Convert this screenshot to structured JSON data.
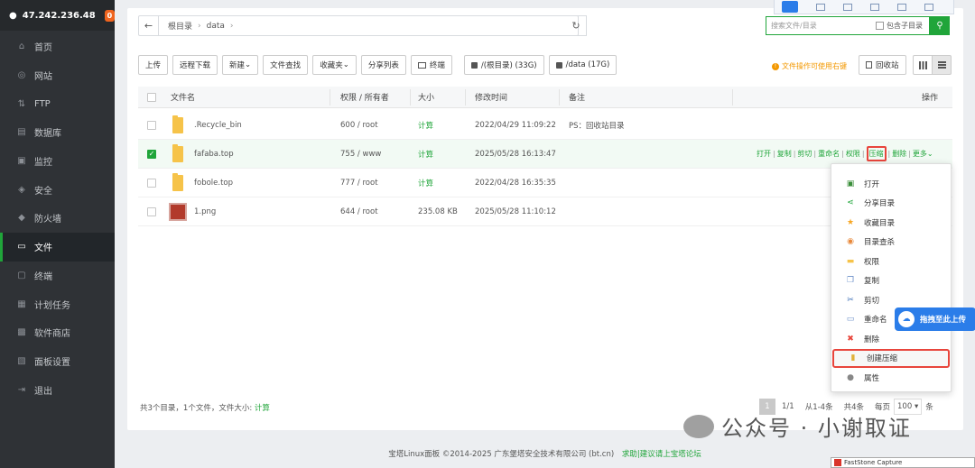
{
  "sidebar": {
    "ip": "47.242.236.48",
    "badge": "0",
    "items": [
      {
        "label": "首页",
        "icon": "home-icon"
      },
      {
        "label": "网站",
        "icon": "globe-icon"
      },
      {
        "label": "FTP",
        "icon": "ftp-icon"
      },
      {
        "label": "数据库",
        "icon": "database-icon"
      },
      {
        "label": "监控",
        "icon": "monitor-icon"
      },
      {
        "label": "安全",
        "icon": "shield-icon"
      },
      {
        "label": "防火墙",
        "icon": "firewall-icon"
      },
      {
        "label": "文件",
        "icon": "folder-icon",
        "active": true
      },
      {
        "label": "终端",
        "icon": "terminal-icon"
      },
      {
        "label": "计划任务",
        "icon": "calendar-icon"
      },
      {
        "label": "软件商店",
        "icon": "apps-icon"
      },
      {
        "label": "面板设置",
        "icon": "settings-icon"
      },
      {
        "label": "退出",
        "icon": "logout-icon"
      }
    ]
  },
  "path": {
    "root": "根目录",
    "dir": "data"
  },
  "search": {
    "placeholder": "搜索文件/目录",
    "include_sub": "包含子目录"
  },
  "toolbar": {
    "upload": "上传",
    "remote_download": "远程下载",
    "new": "新建",
    "file_search": "文件查找",
    "favorites": "收藏夹",
    "share_list": "分享列表",
    "terminal": "终端",
    "disk_root": "/(根目录) (33G)",
    "disk_data": "/data (17G)"
  },
  "hint": "文件操作可使用右键",
  "recycle": "回收站",
  "table": {
    "headers": {
      "name": "文件名",
      "perm": "权限 / 所有者",
      "size": "大小",
      "mtime": "修改时间",
      "note": "备注",
      "ops": "操作"
    },
    "rows": [
      {
        "name": ".Recycle_bin",
        "perm": "600 / root",
        "size": "计算",
        "mtime": "2022/04/29 11:09:22",
        "note": "PS：回收站目录",
        "type": "folder"
      },
      {
        "name": "fafaba.top",
        "perm": "755 / www",
        "size": "计算",
        "mtime": "2025/05/28 16:13:47",
        "note": "",
        "type": "folder",
        "selected": true
      },
      {
        "name": "fobole.top",
        "perm": "777 / root",
        "size": "计算",
        "mtime": "2022/04/28 16:35:35",
        "note": "",
        "type": "folder"
      },
      {
        "name": "1.png",
        "perm": "644 / root",
        "size": "235.08 KB",
        "mtime": "2025/05/28 11:10:12",
        "note": "",
        "type": "image"
      }
    ],
    "row_ops": {
      "open": "打开",
      "copy": "复制",
      "cut": "剪切",
      "rename": "重命名",
      "perm": "权限",
      "compress": "压缩",
      "delete": "删除",
      "more": "更多"
    }
  },
  "context_menu": [
    {
      "label": "打开",
      "icon": "open-icon",
      "color": "#3a8e3a"
    },
    {
      "label": "分享目录",
      "icon": "share-icon",
      "color": "#20a53a"
    },
    {
      "label": "收藏目录",
      "icon": "star-icon",
      "color": "#f6a623"
    },
    {
      "label": "目录查杀",
      "icon": "scan-icon",
      "color": "#e8883a"
    },
    {
      "label": "权限",
      "icon": "lock-icon",
      "color": "#f6c349"
    },
    {
      "label": "复制",
      "icon": "copy-icon",
      "color": "#6b8fc9"
    },
    {
      "label": "剪切",
      "icon": "scissors-icon",
      "color": "#3d6fb6"
    },
    {
      "label": "重命名",
      "icon": "rename-icon",
      "color": "#6b8fc9"
    },
    {
      "label": "删除",
      "icon": "delete-icon",
      "color": "#e8453c"
    },
    {
      "label": "创建压缩",
      "icon": "archive-icon",
      "color": "#e0b13a",
      "highlight": true
    },
    {
      "label": "属性",
      "icon": "properties-icon",
      "color": "#888888"
    }
  ],
  "upload_float": "拖拽至此上传",
  "summary": {
    "text": "共3个目录，1个文件，文件大小:",
    "calc": "计算"
  },
  "pager": {
    "current": "1",
    "total_pages": "1/1",
    "range": "从1-4条",
    "total": "共4条",
    "per_page_label": "每页",
    "per_page": "100",
    "unit": "条"
  },
  "watermark": "公众号 · 小谢取证",
  "copyright": {
    "text": "宝塔Linux面板 ©2014-2025 广东堡塔安全技术有限公司 (bt.cn)",
    "link": "求助|建议请上宝塔论坛"
  },
  "faststone": "FastStone Capture",
  "colors": {
    "accent": "#20a53a",
    "sidebar_bg": "#2f3236",
    "highlight_red": "#e8453c"
  }
}
